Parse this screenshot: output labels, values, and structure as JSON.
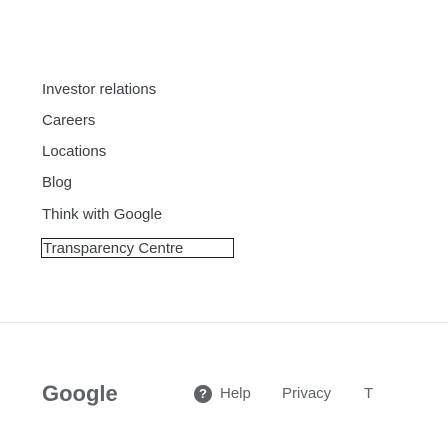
{
  "links": [
    {
      "label": "Investor relations"
    },
    {
      "label": "Careers"
    },
    {
      "label": "Locations"
    },
    {
      "label": "Blog"
    },
    {
      "label": "Think with Google"
    },
    {
      "label": "Transparency Centre"
    }
  ],
  "footer": {
    "logo": "Google",
    "help_icon": "help-icon",
    "help_label": "Help",
    "privacy_label": "Privacy",
    "terms_label": "T"
  }
}
